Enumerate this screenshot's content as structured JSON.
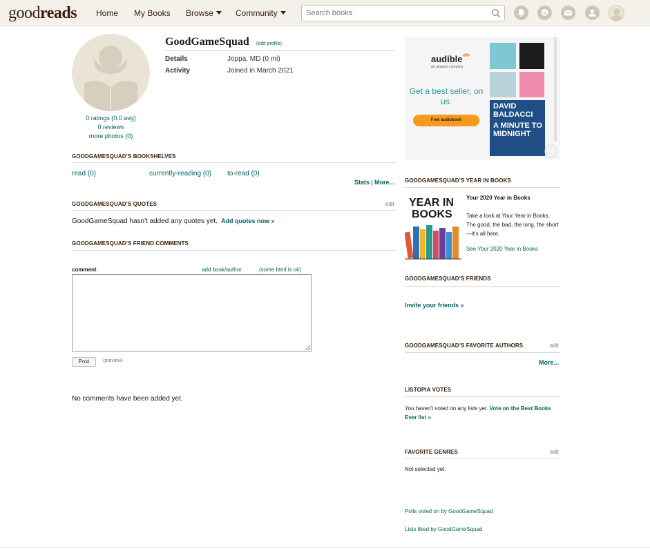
{
  "header": {
    "logo_good": "good",
    "logo_reads": "reads",
    "nav": [
      "Home",
      "My Books",
      "Browse",
      "Community"
    ],
    "search_placeholder": "Search books",
    "icons": [
      "notifications-icon",
      "discussions-icon",
      "messages-icon",
      "friends-icon",
      "profile-icon"
    ]
  },
  "profile": {
    "name": "GoodGameSquad",
    "edit_profile": "(edit profile)",
    "details_label": "Details",
    "details_value": "Joppa, MD (0 mi)",
    "activity_label": "Activity",
    "activity_value": "Joined in March 2021",
    "ratings": "0 ratings (0.0 avg)",
    "reviews": "0 reviews",
    "photos": "more photos (0)"
  },
  "bookshelves": {
    "title": "GOODGAMESQUAD’S BOOKSHELVES",
    "shelves": [
      "read (0)",
      "currently-reading (0)",
      "to-read (0)"
    ],
    "stats": "Stats",
    "sep": "|",
    "more": "More..."
  },
  "quotes": {
    "title": "GOODGAMESQUAD’S QUOTES",
    "edit": "edit",
    "text": "GoodGameSquad hasn't added any quotes yet.",
    "add": "Add quotes now »"
  },
  "friend_comments": {
    "title": "GOODGAMESQUAD’S FRIEND COMMENTS",
    "comment_label": "comment",
    "add_book": "add book/author",
    "html_ok": "(some html is ok)",
    "post": "Post",
    "preview": "(preview)",
    "empty": "No comments have been added yet."
  },
  "ad": {
    "brand": "audible",
    "brand_sub": "an amazon company",
    "headline": "Get a best seller, on us.",
    "cta": "Free audiobook",
    "cover_author": "DAVID BALDACCI",
    "cover_title": "A MINUTE TO MIDNIGHT"
  },
  "year_in_books": {
    "title": "GOODGAMESQUAD’S YEAR IN BOOKS",
    "art_line1": "YEAR IN",
    "art_line2": "BOOKS",
    "heading": "Your 2020 Year in Books",
    "text": "Take a look at Your Year in Books. The good, the bad, the long, the short—it's all here.",
    "link": "See Your 2020 Year in Books"
  },
  "friends": {
    "title": "GOODGAMESQUAD’S FRIENDS",
    "invite": "Invite your friends »"
  },
  "favorite_authors": {
    "title": "GOODGAMESQUAD’S FAVORITE AUTHORS",
    "edit": "edit",
    "more": "More..."
  },
  "listopia": {
    "title": "LISTOPIA VOTES",
    "text": "You haven't voted on any lists yet.",
    "link": "Vote on the Best Books Ever list »"
  },
  "genres": {
    "title": "FAVORITE GENRES",
    "edit": "edit",
    "text": "Not selected yet."
  },
  "footer_links": {
    "polls": "Polls voted on by GoodGameSquad",
    "lists": "Lists liked by GoodGameSquad"
  },
  "colors": {
    "header_bg": "#f4f1ea",
    "link": "#00635d",
    "brown": "#382110",
    "cta": "#f7991c"
  }
}
